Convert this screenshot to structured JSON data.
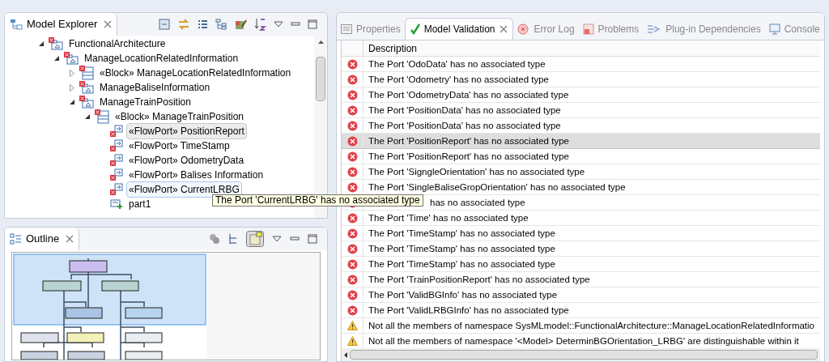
{
  "model_explorer": {
    "title": "Model Explorer",
    "tree": [
      {
        "label": "FunctionalArchitecture",
        "kind": "package",
        "expanded": true,
        "children": [
          {
            "label": "ManageLocationRelatedInformation",
            "kind": "package",
            "expanded": true,
            "children": [
              {
                "label": "«Block» ManageLocationRelatedInformation",
                "kind": "block",
                "expanded": false
              },
              {
                "label": "ManageBaliseInformation",
                "kind": "package",
                "expanded": false
              },
              {
                "label": "ManageTrainPosition",
                "kind": "package",
                "expanded": true,
                "children": [
                  {
                    "label": "«Block» ManageTrainPosition",
                    "kind": "block",
                    "expanded": true,
                    "children": [
                      {
                        "label": "«FlowPort» PositionReport",
                        "kind": "flowport",
                        "selected": true,
                        "hovered": false
                      },
                      {
                        "label": "«FlowPort» TimeStamp",
                        "kind": "flowport",
                        "selected": false,
                        "hovered": false
                      },
                      {
                        "label": "«FlowPort» OdometryData",
                        "kind": "flowport",
                        "selected": false,
                        "hovered": false
                      },
                      {
                        "label": "«FlowPort» Balises Information",
                        "kind": "flowport",
                        "selected": false,
                        "hovered": false
                      },
                      {
                        "label": "«FlowPort» CurrentLRBG",
                        "kind": "flowport",
                        "selected": false,
                        "hovered": true
                      },
                      {
                        "label": "part1",
                        "kind": "part",
                        "selected": false,
                        "hovered": false
                      }
                    ]
                  }
                ]
              }
            ]
          }
        ]
      }
    ],
    "tooltip": "The Port 'CurrentLRBG' has no associated type"
  },
  "outline": {
    "title": "Outline"
  },
  "tabs": [
    {
      "label": "Properties",
      "selected": false
    },
    {
      "label": "Model Validation",
      "selected": true
    },
    {
      "label": "Error Log",
      "selected": false
    },
    {
      "label": "Problems",
      "selected": false
    },
    {
      "label": "Plug-in Dependencies",
      "selected": false
    },
    {
      "label": "Console",
      "selected": false
    }
  ],
  "validation": {
    "columns": [
      "Description"
    ],
    "rows": [
      {
        "kind": "error",
        "text": "The Port 'OdoData' has no associated type",
        "selected": false
      },
      {
        "kind": "error",
        "text": "The Port 'Odometry' has no associated type",
        "selected": false
      },
      {
        "kind": "error",
        "text": "The Port 'OdometryData' has no associated type",
        "selected": false
      },
      {
        "kind": "error",
        "text": "The Port 'PositionData' has no associated type",
        "selected": false
      },
      {
        "kind": "error",
        "text": "The Port 'PositionData' has no associated type",
        "selected": false
      },
      {
        "kind": "error",
        "text": "The Port 'PositionReport' has no associated type",
        "selected": true
      },
      {
        "kind": "error",
        "text": "The Port 'PositionReport' has no associated type",
        "selected": false
      },
      {
        "kind": "error",
        "text": "The Port 'SigngleOrientation' has no associated type",
        "selected": false
      },
      {
        "kind": "error",
        "text": "The Port 'SingleBaliseGropOrientation' has no associated type",
        "selected": false
      },
      {
        "kind": "error",
        "text": "has no associated type",
        "selected": false
      },
      {
        "kind": "error",
        "text": "The Port 'Time' has no associated type",
        "selected": false
      },
      {
        "kind": "error",
        "text": "The Port 'TimeStamp' has no associated type",
        "selected": false
      },
      {
        "kind": "error",
        "text": "The Port 'TimeStamp' has no associated type",
        "selected": false
      },
      {
        "kind": "error",
        "text": "The Port 'TimeStamp' has no associated type",
        "selected": false
      },
      {
        "kind": "error",
        "text": "The Port 'TrainPositionReport' has no associated type",
        "selected": false
      },
      {
        "kind": "error",
        "text": "The Port 'ValidBGInfo' has no associated type",
        "selected": false
      },
      {
        "kind": "error",
        "text": "The Port 'ValidLRBGInfo' has no associated type",
        "selected": false
      },
      {
        "kind": "warning",
        "text": "Not all the members of namespace SysMLmodel::FunctionalArchitecture::ManageLocationRelatedInformatio",
        "selected": false
      },
      {
        "kind": "warning",
        "text": "Not all the members of namespace '<Model> DeterminBGOrientation_LRBG' are distinguishable within it",
        "selected": false
      }
    ]
  }
}
